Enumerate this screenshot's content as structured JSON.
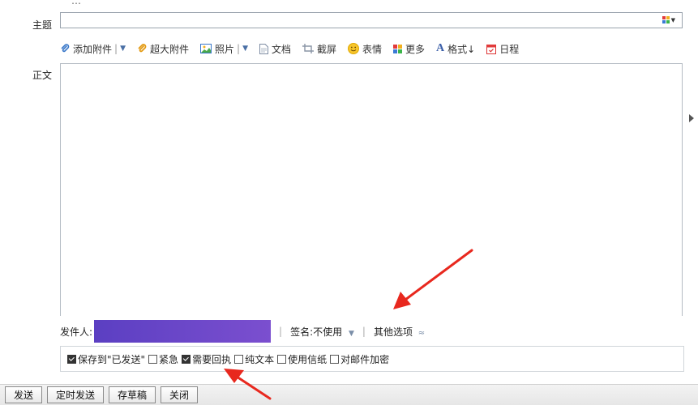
{
  "compose": {
    "subject_label": "主题",
    "body_label": "正文",
    "subject_value": "",
    "top_partial_text": "…"
  },
  "toolbar": {
    "items": [
      {
        "label": "添加附件",
        "icon": "paperclip-icon",
        "has_dropdown": true
      },
      {
        "label": "超大附件",
        "icon": "big-attachment-icon",
        "has_dropdown": false
      },
      {
        "label": "照片",
        "icon": "photo-icon",
        "has_dropdown": true
      },
      {
        "label": "文档",
        "icon": "document-icon",
        "has_dropdown": false
      },
      {
        "label": "截屏",
        "icon": "screenshot-icon",
        "has_dropdown": false
      },
      {
        "label": "表情",
        "icon": "emoji-icon",
        "has_dropdown": false
      },
      {
        "label": "更多",
        "icon": "more-icon",
        "has_dropdown": false
      },
      {
        "label": "格式↓",
        "icon": "format-icon",
        "has_dropdown": false
      },
      {
        "label": "日程",
        "icon": "calendar-icon",
        "has_dropdown": false
      }
    ]
  },
  "sender": {
    "label": "发件人:",
    "signature_label": "签名:",
    "signature_value": "不使用",
    "other_options": "其他选项"
  },
  "options": [
    {
      "label": "保存到\"已发送\"",
      "checked": true
    },
    {
      "label": "紧急",
      "checked": false
    },
    {
      "label": "需要回执",
      "checked": true
    },
    {
      "label": "纯文本",
      "checked": false
    },
    {
      "label": "使用信纸",
      "checked": false
    },
    {
      "label": "对邮件加密",
      "checked": false
    }
  ],
  "actions": {
    "send": "发送",
    "scheduled_send": "定时发送",
    "save_draft": "存草稿",
    "close": "关闭"
  },
  "colors": {
    "sender_block_start": "#5b3fc2",
    "sender_block_end": "#7b4fcf",
    "annotation_arrow": "#e8281e"
  }
}
